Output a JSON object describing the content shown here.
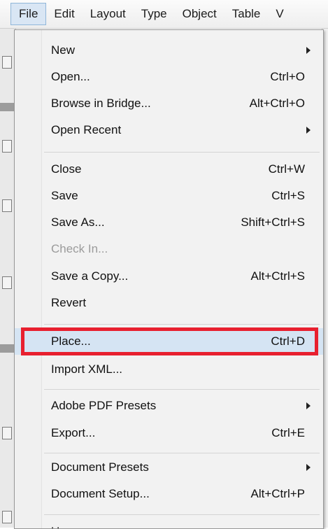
{
  "menubar": {
    "items": [
      "File",
      "Edit",
      "Layout",
      "Type",
      "Object",
      "Table",
      "V"
    ]
  },
  "file_menu": {
    "items": [
      {
        "label": "New",
        "shortcut": "",
        "submenu": true
      },
      {
        "label": "Open...",
        "shortcut": "Ctrl+O"
      },
      {
        "label": "Browse in Bridge...",
        "shortcut": "Alt+Ctrl+O"
      },
      {
        "label": "Open Recent",
        "shortcut": "",
        "submenu": true
      },
      {
        "label": "Close",
        "shortcut": "Ctrl+W"
      },
      {
        "label": "Save",
        "shortcut": "Ctrl+S"
      },
      {
        "label": "Save As...",
        "shortcut": "Shift+Ctrl+S"
      },
      {
        "label": "Check In...",
        "shortcut": "",
        "disabled": true
      },
      {
        "label": "Save a Copy...",
        "shortcut": "Alt+Ctrl+S"
      },
      {
        "label": "Revert",
        "shortcut": ""
      },
      {
        "label": "Place...",
        "shortcut": "Ctrl+D",
        "highlighted": true
      },
      {
        "label": "Import XML...",
        "shortcut": ""
      },
      {
        "label": "Adobe PDF Presets",
        "shortcut": "",
        "submenu": true
      },
      {
        "label": "Export...",
        "shortcut": "Ctrl+E"
      },
      {
        "label": "Document Presets",
        "shortcut": "",
        "submenu": true
      },
      {
        "label": "Document Setup...",
        "shortcut": "Alt+Ctrl+P"
      },
      {
        "label": "U",
        "shortcut": ""
      }
    ]
  },
  "colors": {
    "highlight": "#d5e4f3",
    "annotation_box": "#e8202f",
    "disabled_text": "#9b9b9b"
  }
}
